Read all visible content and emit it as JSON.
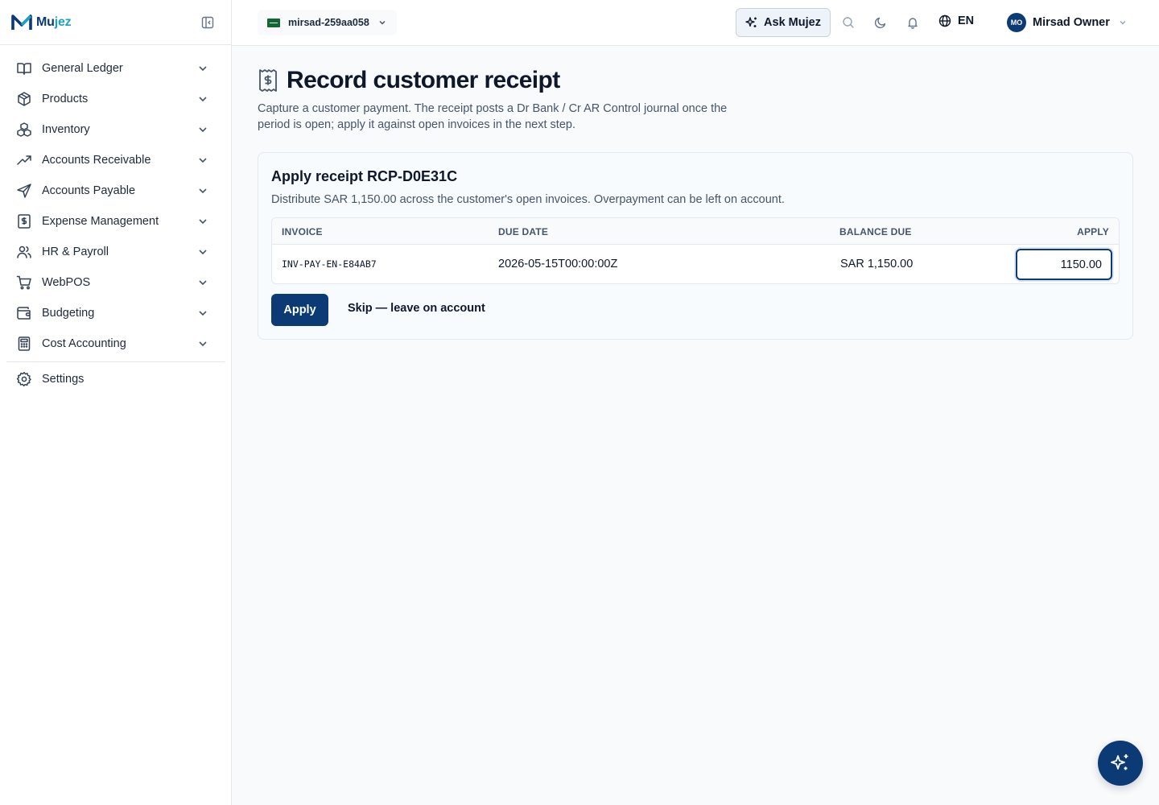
{
  "brand": {
    "name_part1": "Mu",
    "name_part2": "jez",
    "color_primary": "#0b3a75",
    "color_accent": "#1da1c7"
  },
  "sidebar": {
    "items": [
      {
        "label": "General Ledger",
        "icon": "book-open-icon"
      },
      {
        "label": "Products",
        "icon": "package-icon"
      },
      {
        "label": "Inventory",
        "icon": "boxes-icon"
      },
      {
        "label": "Accounts Receivable",
        "icon": "trending-up-icon"
      },
      {
        "label": "Accounts Payable",
        "icon": "send-icon"
      },
      {
        "label": "Expense Management",
        "icon": "receipt-icon"
      },
      {
        "label": "HR & Payroll",
        "icon": "users-icon"
      },
      {
        "label": "WebPOS",
        "icon": "cart-icon"
      },
      {
        "label": "Budgeting",
        "icon": "wallet-icon"
      },
      {
        "label": "Cost Accounting",
        "icon": "calculator-icon"
      }
    ],
    "settings_label": "Settings"
  },
  "topbar": {
    "org_name": "mirsad-259aa058",
    "ask_label": "Ask Mujez",
    "language": "EN",
    "user_initials": "MO",
    "user_name": "Mirsad Owner"
  },
  "page": {
    "title": "Record customer receipt",
    "description": "Capture a customer payment. The receipt posts a Dr Bank / Cr AR Control journal once the period is open; apply it against open invoices in the next step."
  },
  "card": {
    "title": "Apply receipt RCP-D0E31C",
    "subtitle": "Distribute SAR 1,150.00 across the customer's open invoices. Overpayment can be left on account.",
    "columns": {
      "invoice": "INVOICE",
      "due_date": "DUE DATE",
      "balance_due": "BALANCE DUE",
      "apply": "APPLY"
    },
    "rows": [
      {
        "invoice": "INV-PAY-EN-E84AB7",
        "due_date": "2026-05-15T00:00:00Z",
        "balance_due": "SAR 1,150.00",
        "apply_value": "1150.00"
      }
    ],
    "apply_button": "Apply",
    "skip_button": "Skip — leave on account"
  }
}
